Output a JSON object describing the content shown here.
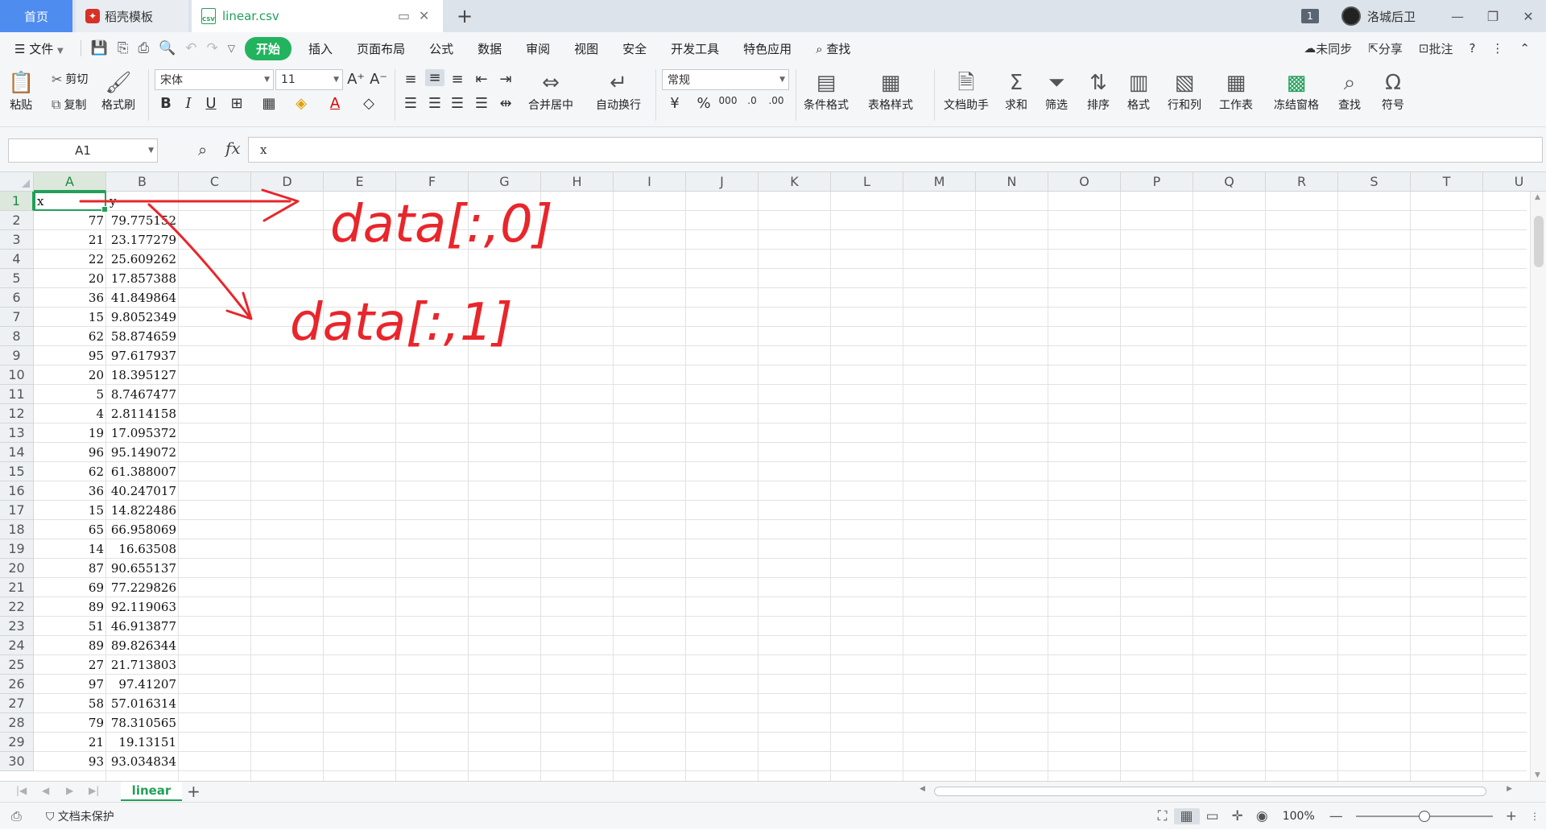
{
  "tabs": {
    "home": "首页",
    "template": "稻壳模板",
    "file": "linear.csv",
    "add": "+"
  },
  "window": {
    "badge": "1",
    "user": "洛城后卫",
    "minimize": "—",
    "restore": "❐",
    "close": "✕"
  },
  "menu": {
    "file": "文件",
    "items": [
      "开始",
      "插入",
      "页面布局",
      "公式",
      "数据",
      "审阅",
      "视图",
      "安全",
      "开发工具",
      "特色应用"
    ],
    "search": "查找",
    "right": {
      "sync": "未同步",
      "share": "分享",
      "comment": "批注"
    }
  },
  "ribbon": {
    "paste": "粘贴",
    "cut": "剪切",
    "copy": "复制",
    "format_painter": "格式刷",
    "font_name": "宋体",
    "font_size": "11",
    "number_format": "常规",
    "merge": "合并居中",
    "wrap": "自动换行",
    "cond_format": "条件格式",
    "table_style": "表格样式",
    "doc_helper": "文档助手",
    "sum": "求和",
    "filter": "筛选",
    "sort": "排序",
    "format": "格式",
    "rows_cols": "行和列",
    "sheet": "工作表",
    "freeze": "冻结窗格",
    "find": "查找",
    "symbol": "符号"
  },
  "formula_bar": {
    "name_box": "A1",
    "fx": "fx",
    "content": "x"
  },
  "sheet": {
    "columns": [
      "A",
      "B",
      "C",
      "D",
      "E",
      "F",
      "G",
      "H",
      "I",
      "J",
      "K",
      "L",
      "M",
      "N",
      "O",
      "P",
      "Q",
      "R",
      "S",
      "T",
      "U"
    ],
    "header_row": [
      "x",
      "y"
    ],
    "rows": [
      [
        "77",
        "79.775152"
      ],
      [
        "21",
        "23.177279"
      ],
      [
        "22",
        "25.609262"
      ],
      [
        "20",
        "17.857388"
      ],
      [
        "36",
        "41.849864"
      ],
      [
        "15",
        "9.8052349"
      ],
      [
        "62",
        "58.874659"
      ],
      [
        "95",
        "97.617937"
      ],
      [
        "20",
        "18.395127"
      ],
      [
        "5",
        "8.7467477"
      ],
      [
        "4",
        "2.8114158"
      ],
      [
        "19",
        "17.095372"
      ],
      [
        "96",
        "95.149072"
      ],
      [
        "62",
        "61.388007"
      ],
      [
        "36",
        "40.247017"
      ],
      [
        "15",
        "14.822486"
      ],
      [
        "65",
        "66.958069"
      ],
      [
        "14",
        "16.63508"
      ],
      [
        "87",
        "90.655137"
      ],
      [
        "69",
        "77.229826"
      ],
      [
        "89",
        "92.119063"
      ],
      [
        "51",
        "46.913877"
      ],
      [
        "89",
        "89.826344"
      ],
      [
        "27",
        "21.713803"
      ],
      [
        "97",
        "97.41207"
      ],
      [
        "58",
        "57.016314"
      ],
      [
        "79",
        "78.310565"
      ],
      [
        "21",
        "19.13151"
      ],
      [
        "93",
        "93.034834"
      ]
    ],
    "tab_name": "linear",
    "handwriting": [
      "data[:,0]",
      "data[:,1]"
    ],
    "annotation_color": "#e8262b"
  },
  "status": {
    "protect": "文档未保护",
    "zoom": "100%"
  },
  "colors": {
    "accent": "#22b35e",
    "home_tab": "#4e8cf0"
  }
}
